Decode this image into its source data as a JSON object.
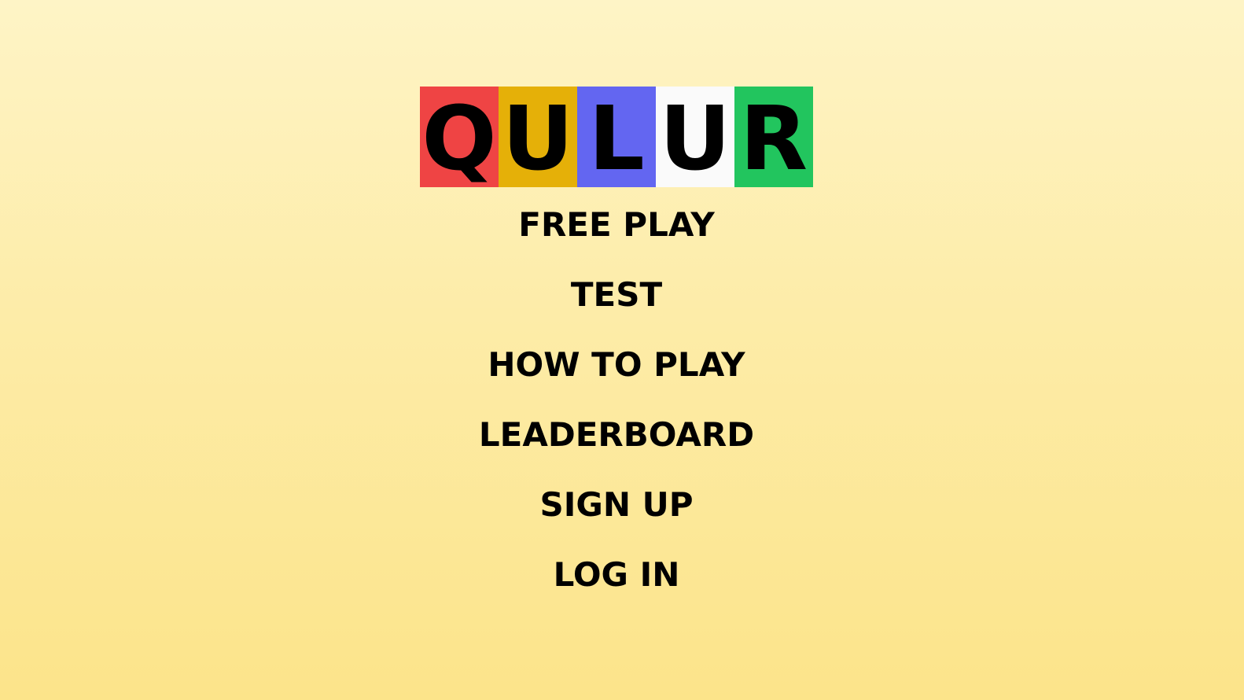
{
  "logo": {
    "tiles": [
      {
        "letter": "Q",
        "color": "#ef4444"
      },
      {
        "letter": "U",
        "color": "#e5b008"
      },
      {
        "letter": "L",
        "color": "#6366f1"
      },
      {
        "letter": "U",
        "color": "#fafafa"
      },
      {
        "letter": "R",
        "color": "#22c55e"
      }
    ]
  },
  "menu": {
    "items": [
      {
        "label": "FREE PLAY"
      },
      {
        "label": "TEST"
      },
      {
        "label": "HOW TO PLAY"
      },
      {
        "label": "LEADERBOARD"
      },
      {
        "label": "SIGN UP"
      },
      {
        "label": "LOG IN"
      }
    ]
  }
}
